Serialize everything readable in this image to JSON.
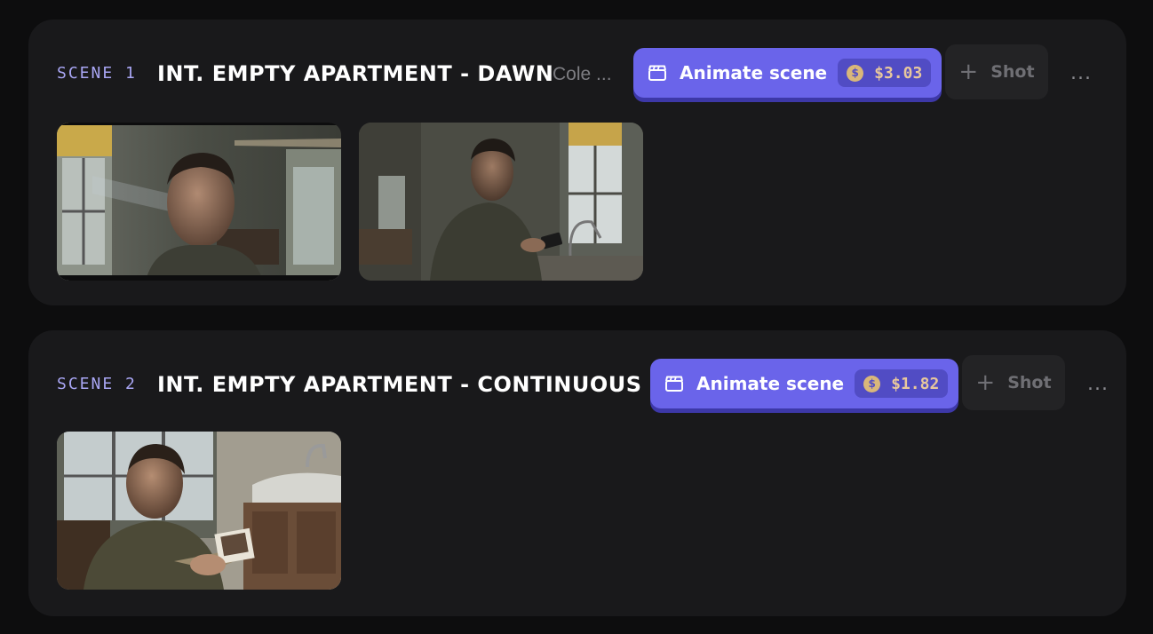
{
  "scenes": [
    {
      "label": "SCENE 1",
      "title": "INT. EMPTY APARTMENT - DAWN",
      "subtitle": "Cole ...",
      "animate_label": "Animate scene",
      "cost": "$3.03",
      "shot_label": "Shot",
      "more_label": "...",
      "thumbnails": [
        "man-closeup-window-light",
        "man-at-sink-with-phone"
      ]
    },
    {
      "label": "SCENE 2",
      "title": "INT. EMPTY APARTMENT - CONTINUOUS",
      "subtitle": "",
      "animate_label": "Animate scene",
      "cost": "$1.82",
      "shot_label": "Shot",
      "more_label": "...",
      "thumbnails": [
        "man-holding-photo"
      ]
    }
  ],
  "icons": {
    "clapperboard": "clapperboard-icon",
    "coin": "coin-icon",
    "coin_glyph": "$",
    "plus": "+"
  },
  "colors": {
    "accent": "#6a64ea",
    "accent_shadow": "#3d38a8",
    "scene_label": "#a9a6f4",
    "cost": "#e7c79d",
    "card_bg": "#19191b",
    "page_bg": "#0d0d0e"
  }
}
